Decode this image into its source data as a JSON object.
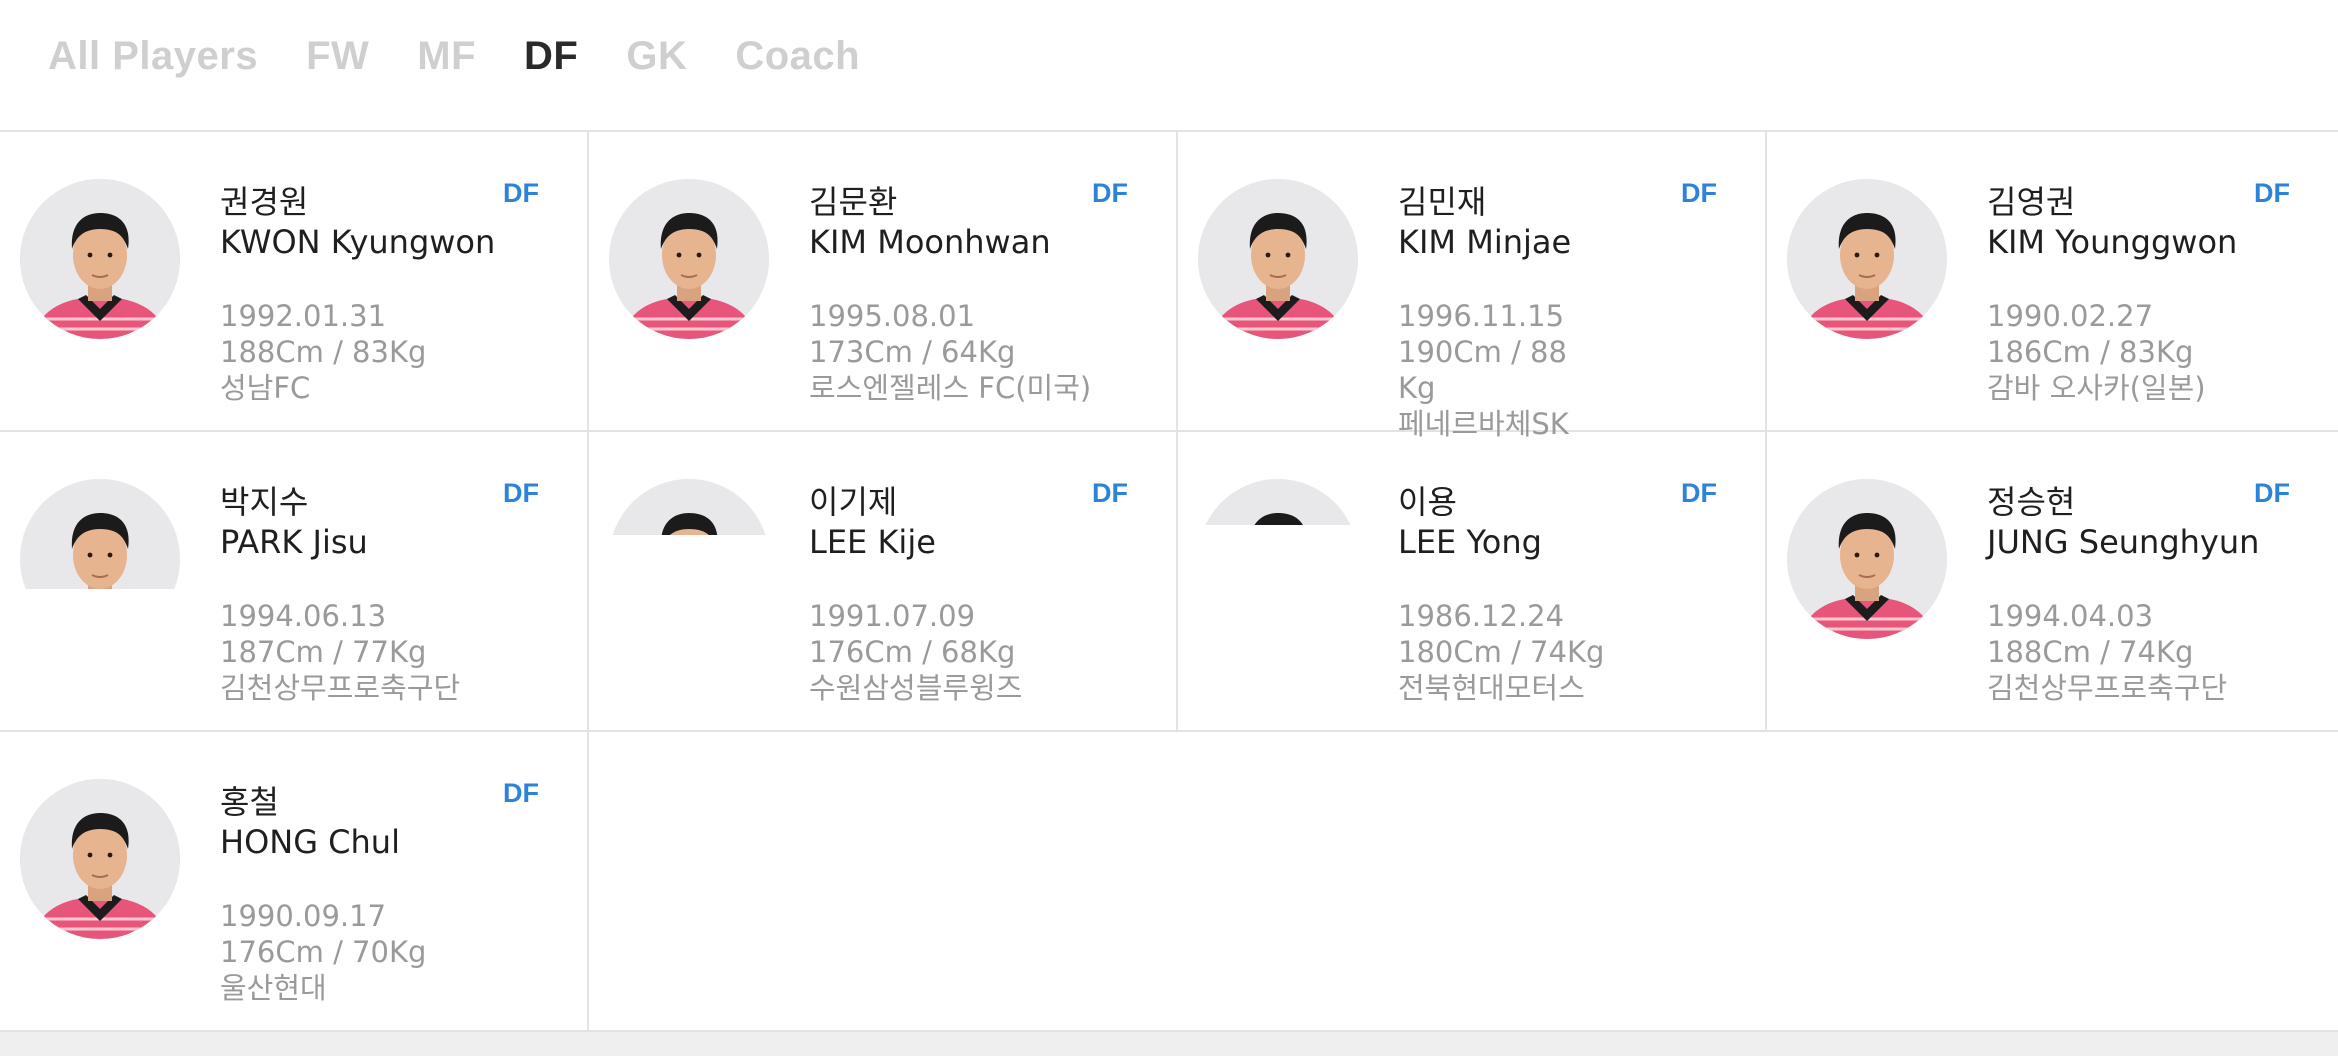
{
  "tabs": [
    "All Players",
    "FW",
    "MF",
    "DF",
    "GK",
    "Coach"
  ],
  "active_tab": "DF",
  "players": [
    {
      "name_ko": "권경원",
      "name_en": "KWON Kyungwon",
      "pos": "DF",
      "dob": "1992.01.31",
      "body": "188Cm / 83Kg",
      "club": "성남FC"
    },
    {
      "name_ko": "김문환",
      "name_en": "KIM Moonhwan",
      "pos": "DF",
      "dob": "1995.08.01",
      "body": "173Cm / 64Kg",
      "club": "로스엔젤레스 FC(미국)"
    },
    {
      "name_ko": "김민재",
      "name_en": "KIM Minjae",
      "pos": "DF",
      "dob": "1996.11.15",
      "body": "190Cm / 88Kg",
      "club": "페네르바체SK"
    },
    {
      "name_ko": "김영권",
      "name_en": "KIM Younggwon",
      "pos": "DF",
      "dob": "1990.02.27",
      "body": "186Cm / 83Kg",
      "club": "감바 오사카(일본)"
    },
    {
      "name_ko": "박지수",
      "name_en": "PARK Jisu",
      "pos": "DF",
      "dob": "1994.06.13",
      "body": "187Cm / 77Kg",
      "club": "김천상무프로축구단"
    },
    {
      "name_ko": "이기제",
      "name_en": "LEE Kije",
      "pos": "DF",
      "dob": "1991.07.09",
      "body": "176Cm / 68Kg",
      "club": "수원삼성블루윙즈"
    },
    {
      "name_ko": "이용",
      "name_en": "LEE Yong",
      "pos": "DF",
      "dob": "1986.12.24",
      "body": "180Cm / 74Kg",
      "club": "전북현대모터스"
    },
    {
      "name_ko": "정승현",
      "name_en": "JUNG Seunghyun",
      "pos": "DF",
      "dob": "1994.04.03",
      "body": "188Cm / 74Kg",
      "club": "김천상무프로축구단"
    },
    {
      "name_ko": "홍철",
      "name_en": "HONG Chul",
      "pos": "DF",
      "dob": "1990.09.17",
      "body": "176Cm / 70Kg",
      "club": "울산현대"
    }
  ],
  "colors": {
    "position_accent": "#2d83d8",
    "jersey_pink": "#e8557a",
    "jersey_collar": "#1c1c1c",
    "tab_active": "#2a2a2a",
    "tab_inactive": "#cfcfcf"
  }
}
